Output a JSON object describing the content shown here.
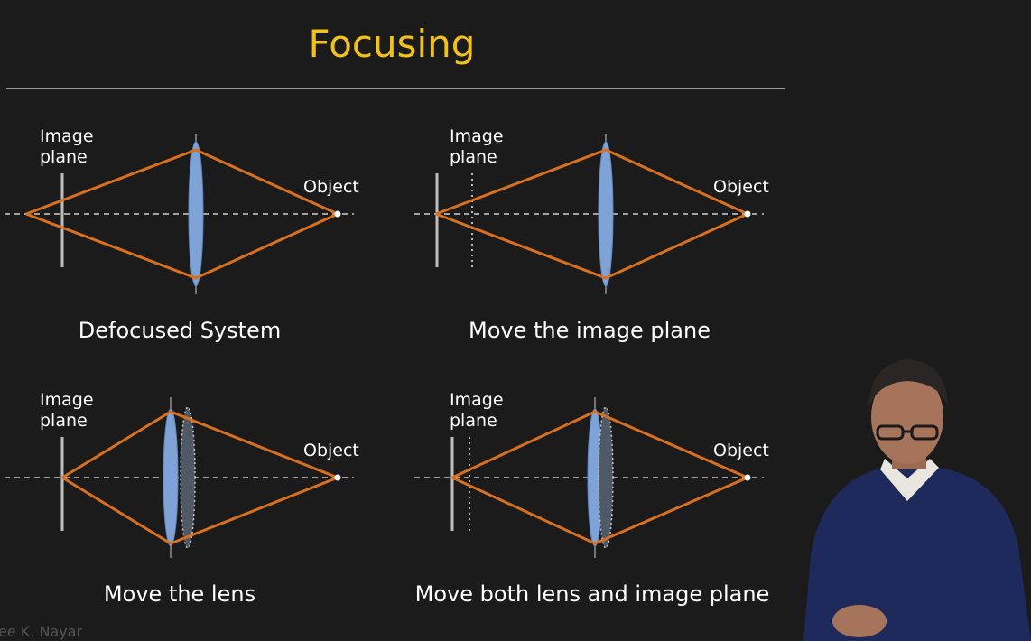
{
  "slide": {
    "title": "Focusing"
  },
  "panels": [
    {
      "id": "defocused",
      "image_plane_label": "Image\nplane",
      "object_label": "Object",
      "caption": "Defocused System"
    },
    {
      "id": "move-image-plane",
      "image_plane_label": "Image\nplane",
      "object_label": "Object",
      "caption": "Move the image plane"
    },
    {
      "id": "move-lens",
      "image_plane_label": "Image\nplane",
      "object_label": "Object",
      "caption": "Move the lens"
    },
    {
      "id": "move-both",
      "image_plane_label": "Image\nplane",
      "object_label": "Object",
      "caption": "Move both lens and image plane"
    }
  ],
  "colors": {
    "title": "#f2c21b",
    "ray": "#d9701f",
    "lens": "#7fa3d6",
    "axis": "#cfcfcf"
  },
  "footer": {
    "watermark": "ee K. Nayar"
  }
}
